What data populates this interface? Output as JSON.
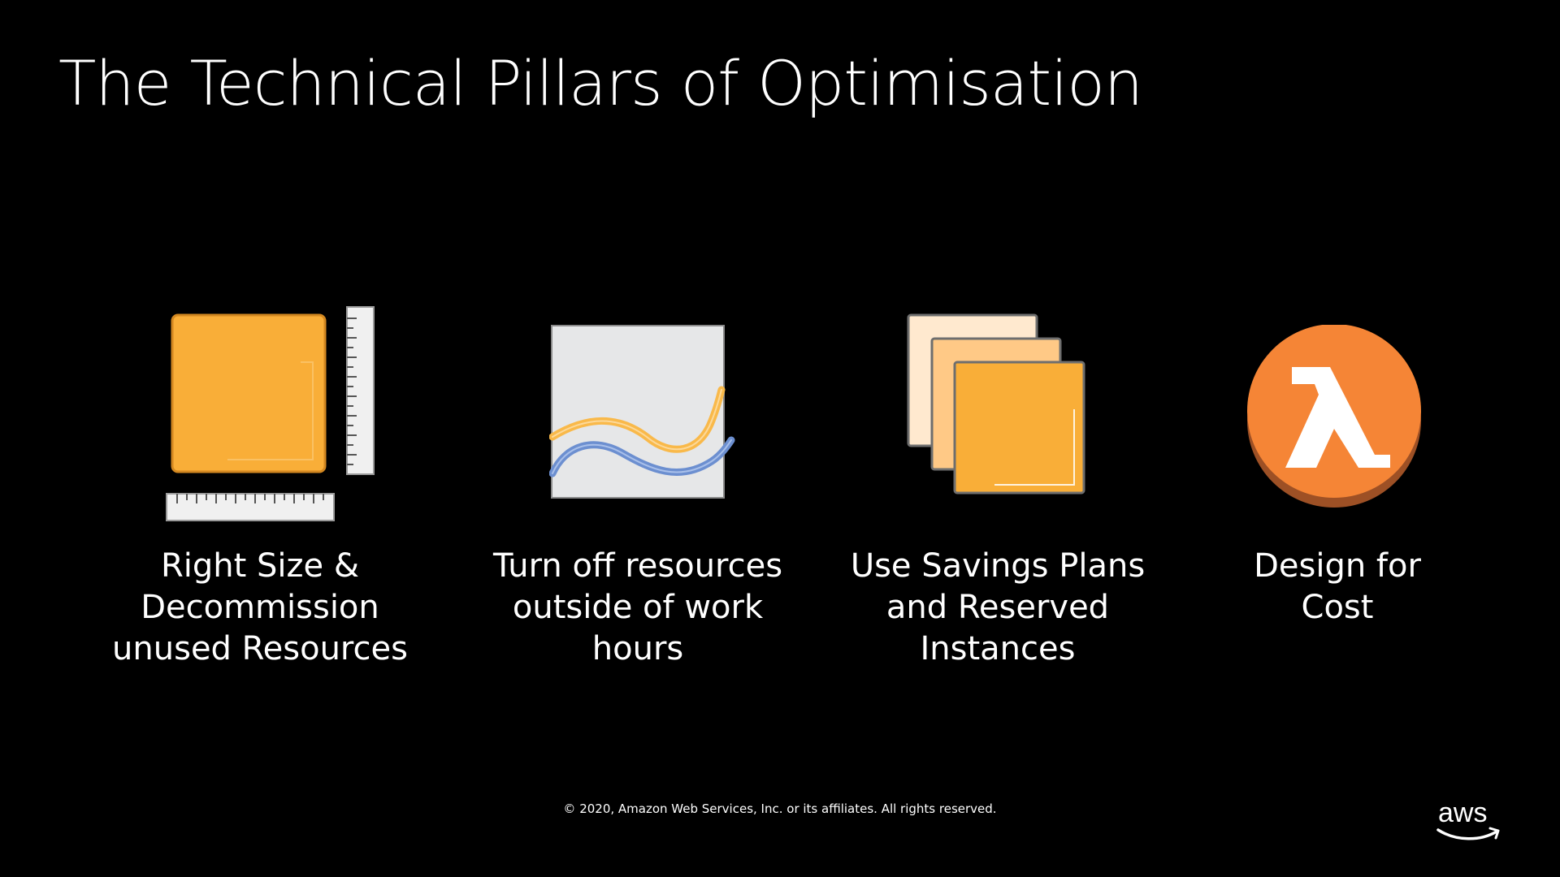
{
  "slide": {
    "title": "The Technical Pillars of Optimisation",
    "pillars": [
      {
        "icon": "right-size-ruler-icon",
        "caption": [
          "Right Size &",
          "Decommission",
          "unused Resources"
        ]
      },
      {
        "icon": "usage-graph-icon",
        "caption": [
          "Turn off resources",
          "outside of work",
          "hours"
        ]
      },
      {
        "icon": "stacked-instances-icon",
        "caption": [
          "Use Savings Plans",
          "and Reserved",
          "Instances"
        ]
      },
      {
        "icon": "lambda-icon",
        "caption": [
          "Design for",
          "Cost"
        ]
      }
    ],
    "footer": "© 2020, Amazon Web Services, Inc. or its affiliates. All rights reserved.",
    "logo_text": "aws"
  },
  "colors": {
    "background": "#000000",
    "text": "#ffffff",
    "orange": "#F9AE38",
    "lambda_orange": "#F58536",
    "lambda_shadow": "#9D5025",
    "graph_yellow": "#F9B94A",
    "graph_blue": "#6C8FD0"
  }
}
